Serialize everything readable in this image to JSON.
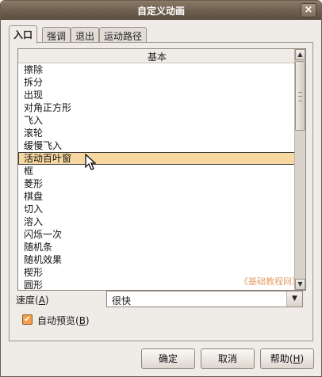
{
  "window": {
    "title": "自定义动画",
    "close_glyph": "×"
  },
  "tabs": [
    {
      "label": "入口",
      "active": true
    },
    {
      "label": "强调",
      "active": false
    },
    {
      "label": "退出",
      "active": false
    },
    {
      "label": "运动路径",
      "active": false
    }
  ],
  "effect_list": {
    "category_header": "基本",
    "selected_index": 8,
    "items": [
      "擦除",
      "拆分",
      "出现",
      "对角正方形",
      "飞入",
      "滚轮",
      "缓慢飞入",
      "活动百叶窗",
      "框",
      "菱形",
      "棋盘",
      "切入",
      "溶入",
      "闪烁一次",
      "随机条",
      "随机效果",
      "楔形",
      "圆形"
    ],
    "watermark": "《基础教程网》"
  },
  "speed": {
    "label": "速度(",
    "mnemonic": "A",
    "label_end": ")",
    "value": "很快"
  },
  "auto_preview": {
    "label": "自动预览(",
    "mnemonic": "B",
    "label_end": ")",
    "checked": true
  },
  "buttons": {
    "ok": "确定",
    "cancel": "取消",
    "help_label": "帮助(",
    "help_mnemonic": "H",
    "help_end": ")"
  },
  "colors": {
    "selection": "#f7d8a0",
    "checkbox": "#f5a04a",
    "titlebar": "#6e604f"
  },
  "icons": {
    "close": "close-icon",
    "scroll_up": "up-arrow-icon",
    "scroll_down": "down-arrow-icon",
    "dropdown": "chevron-down-icon",
    "check": "checkmark-icon"
  }
}
